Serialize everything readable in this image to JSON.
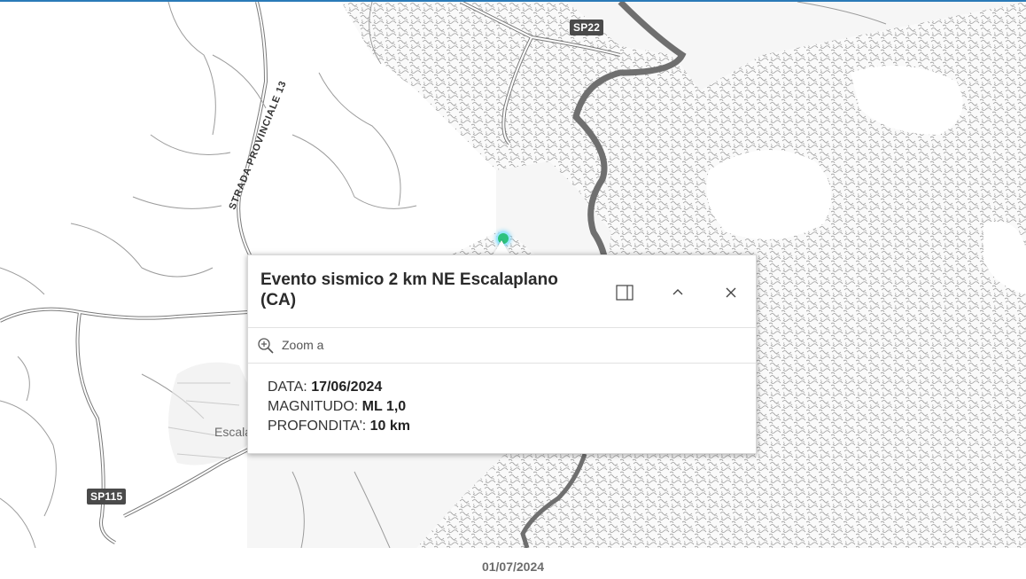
{
  "map": {
    "road_shields": [
      "SP22",
      "SP115"
    ],
    "road_name": "STRADA PROVINCIALE 13",
    "town_label": "Escalaplano"
  },
  "popup": {
    "title": "Evento sismico 2 km NE Escalaplano (CA)",
    "zoom_label": "Zoom a",
    "fields": {
      "date_label": "DATA:",
      "date_value": "17/06/2024",
      "magnitude_label": "MAGNITUDO:",
      "magnitude_value": "ML 1,0",
      "depth_label": "PROFONDITA':",
      "depth_value": "10 km"
    }
  },
  "footer": {
    "date": "01/07/2024"
  }
}
